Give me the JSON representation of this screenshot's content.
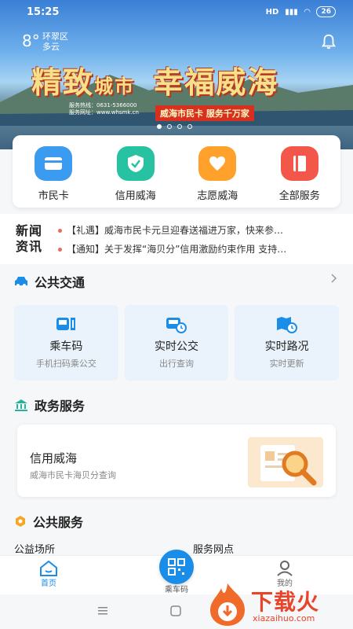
{
  "status_bar": {
    "time": "15:25",
    "network": "HD",
    "battery": "26"
  },
  "weather": {
    "temp": "8°",
    "district": "环翠区",
    "condition": "多云"
  },
  "banner": {
    "headline_1": "精致",
    "headline_1_small": "城市",
    "headline_2": "幸福威海",
    "hotline": "服务热线：0631-5366000",
    "website": "服务网址：www.whsmk.cn",
    "slogan": "威海市民卡 服务千万家",
    "dots": 4,
    "active_dot": 0
  },
  "quick_services": [
    {
      "label": "市民卡",
      "icon": "card-icon",
      "color": "#3a9bf0"
    },
    {
      "label": "信用威海",
      "icon": "shield-check-icon",
      "color": "#27c2a2"
    },
    {
      "label": "志愿威海",
      "icon": "heart-hands-icon",
      "color": "#ffa12b"
    },
    {
      "label": "全部服务",
      "icon": "book-icon",
      "color": "#f2574a"
    }
  ],
  "news": {
    "logo_line1": "新闻",
    "logo_line2": "资讯",
    "items": [
      "【礼遇】威海市民卡元旦迎春送福进万家，快来参…",
      "【通知】关于发挥“海贝分”信用激励约束作用 支持…"
    ]
  },
  "public_transport": {
    "title": "公共交通",
    "cards": [
      {
        "title": "乘车码",
        "subtitle": "手机扫码乘公交",
        "icon": "bus-code-icon"
      },
      {
        "title": "实时公交",
        "subtitle": "出行查询",
        "icon": "bus-clock-icon"
      },
      {
        "title": "实时路况",
        "subtitle": "实时更新",
        "icon": "map-clock-icon"
      }
    ]
  },
  "gov_services": {
    "title": "政务服务",
    "card_title": "信用威海",
    "card_subtitle": "威海市民卡海贝分查询"
  },
  "public_services": {
    "title": "公共服务",
    "left_item": "公益场所",
    "right_item": "服务网点"
  },
  "tabbar": {
    "home": "首页",
    "scan": "乘车码",
    "me": "我的"
  },
  "watermark": {
    "text": "下载火",
    "url": "xiazaihuo.com"
  },
  "colors": {
    "accent": "#1a8de8",
    "news_dot": "#e86c5a"
  }
}
